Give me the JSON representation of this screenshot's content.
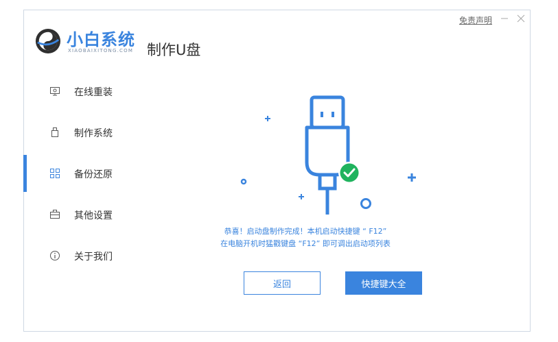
{
  "app": {
    "logo_cn": "小白系统",
    "logo_en": "XIAOBAIXITONG.COM",
    "page_title": "制作U盘"
  },
  "titlebar": {
    "disclaimer": "免责声明"
  },
  "sidebar": {
    "items": [
      {
        "label": "在线重装",
        "icon": "monitor-icon"
      },
      {
        "label": "制作系统",
        "icon": "usb-drive-icon"
      },
      {
        "label": "备份还原",
        "icon": "grid-icon",
        "active": true
      },
      {
        "label": "其他设置",
        "icon": "briefcase-icon"
      },
      {
        "label": "关于我们",
        "icon": "info-icon"
      }
    ]
  },
  "main": {
    "message_line1": "恭喜！启动盘制作完成！本机启动快捷键 “ F12”",
    "message_line2": "在电脑开机时猛戳键盘 “F12” 即可调出启动项列表",
    "back_label": "返回",
    "shortcut_label": "快捷键大全"
  },
  "colors": {
    "accent": "#3a84de",
    "success": "#20b35e"
  }
}
